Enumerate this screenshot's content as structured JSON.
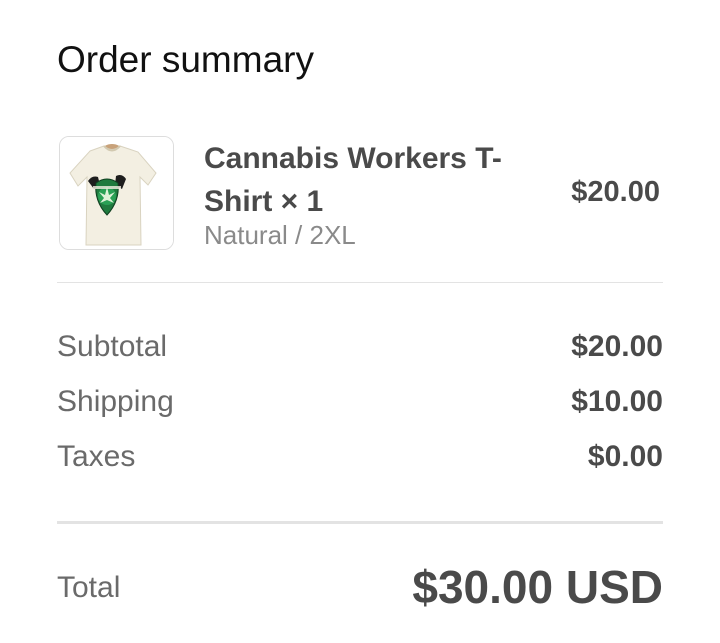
{
  "summary": {
    "title": "Order summary"
  },
  "line_item": {
    "name": "Cannabis Workers T-Shirt × 1",
    "variant": "Natural / 2XL",
    "price": "$20.00",
    "image_icon": "t-shirt-product-image"
  },
  "breakdown": {
    "subtotal_label": "Subtotal",
    "subtotal_value": "$20.00",
    "shipping_label": "Shipping",
    "shipping_value": "$10.00",
    "taxes_label": "Taxes",
    "taxes_value": "$0.00"
  },
  "total": {
    "label": "Total",
    "value": "$30.00 USD"
  },
  "colors": {
    "text_dark": "#4a4a4a",
    "text_muted": "#6a6a6a",
    "divider": "#e3e3e3",
    "logo_green": "#1f7a3e"
  }
}
